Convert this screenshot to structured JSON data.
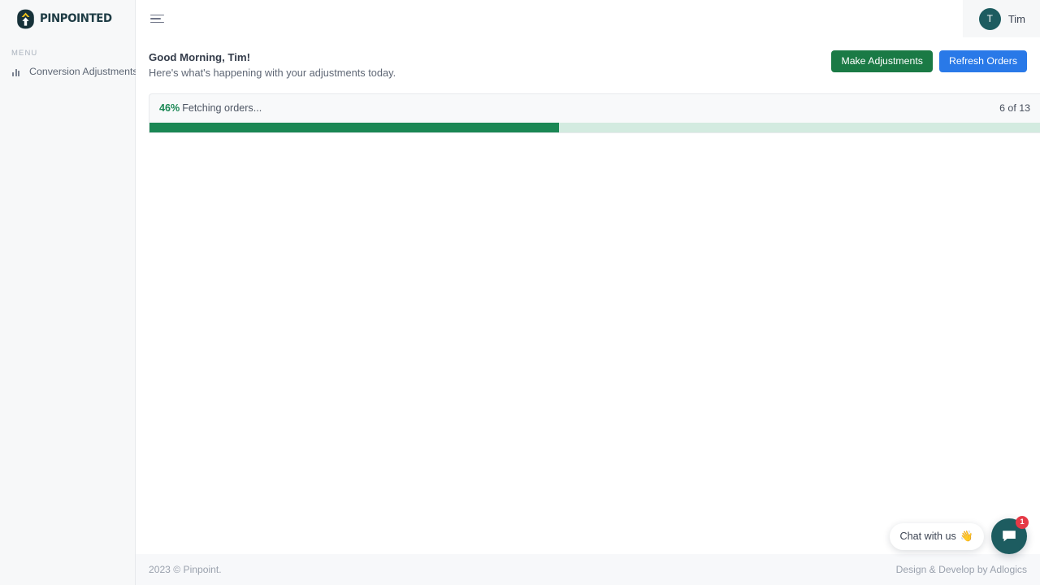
{
  "brand": {
    "wordmark": "PINPOINTED",
    "logo_icon": "pin-arrow-logo-icon"
  },
  "sidebar": {
    "section_label": "MENU",
    "items": [
      {
        "label": "Conversion Adjustments",
        "icon": "bar-chart-icon"
      }
    ]
  },
  "topbar": {
    "menu_toggle_icon": "hamburger-menu-icon",
    "user": {
      "initial": "T",
      "name": "Tim"
    }
  },
  "greeting": {
    "title": "Good Morning, Tim!",
    "subtitle": "Here's what's happening with your adjustments today."
  },
  "actions": {
    "make_adjustments": "Make Adjustments",
    "refresh_orders": "Refresh Orders"
  },
  "progress": {
    "percent_label": "46%",
    "status": "Fetching orders...",
    "count": "6 of 13",
    "percent_value": 46
  },
  "footer": {
    "copyright": "2023 © Pinpoint.",
    "credit": "Design & Develop by Adlogics"
  },
  "chat": {
    "prompt": "Chat with us",
    "wave_emoji": "👋",
    "badge": "1",
    "button_icon": "chat-bubble-icon"
  },
  "colors": {
    "accent_green": "#1a8754",
    "button_green": "#1a7a45",
    "button_blue": "#2979e8",
    "brand_dark": "#1d3b44",
    "avatar_teal": "#1d5c60",
    "badge_red": "#e53946",
    "track_green": "#d3ebe0"
  }
}
